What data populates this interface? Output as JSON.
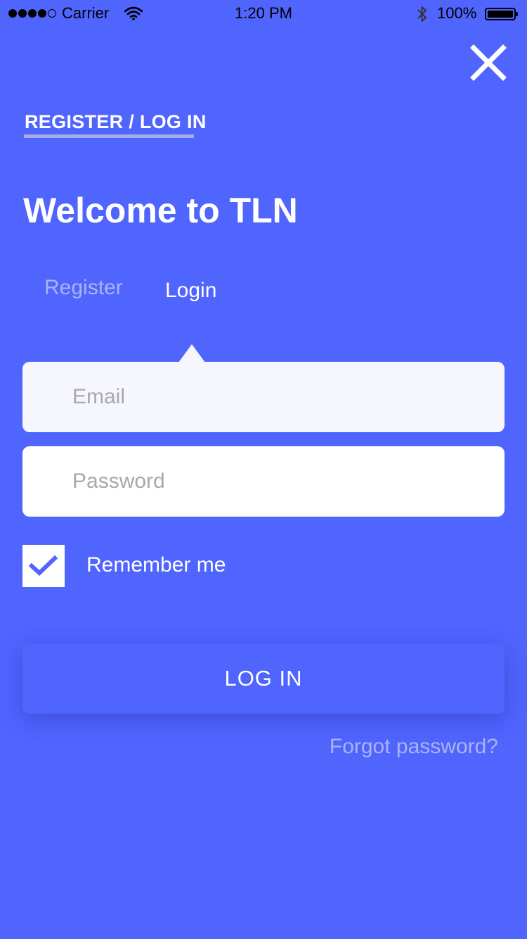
{
  "status_bar": {
    "carrier": "Carrier",
    "time": "1:20 PM",
    "battery": "100%",
    "signal_icon": "signal-dots-icon",
    "wifi_icon": "wifi-icon",
    "bluetooth_icon": "bluetooth-icon",
    "battery_icon": "battery-icon"
  },
  "header": {
    "section_title": "REGISTER / LOG IN",
    "close_icon": "close-icon"
  },
  "main": {
    "welcome_title": "Welcome to TLN",
    "tabs": [
      {
        "label": "Register",
        "active": false
      },
      {
        "label": "Login",
        "active": true
      }
    ]
  },
  "form": {
    "email": {
      "value": "",
      "placeholder": "Email"
    },
    "password": {
      "value": "",
      "placeholder": "Password"
    },
    "remember_me": {
      "label": "Remember me",
      "checked": true,
      "icon": "checkmark-icon"
    },
    "submit_label": "LOG IN",
    "forgot_label": "Forgot password?"
  },
  "colors": {
    "background": "#5064fe",
    "tab_inactive": "#aab3f4",
    "checkmark": "#5064fe",
    "underline": "#a6aee6"
  }
}
